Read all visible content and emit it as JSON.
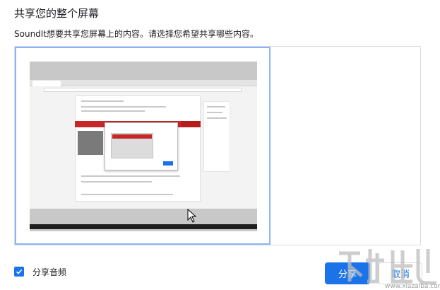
{
  "dialog": {
    "title": "共享您的整个屏幕",
    "description": "SoundIt想要共享您屏幕上的内容。请选择您希望共享哪些内容。"
  },
  "sources": [
    {
      "type": "entire-screen",
      "selected": true
    }
  ],
  "audio": {
    "label": "分享音频",
    "checked": true
  },
  "buttons": {
    "share_label": "分享",
    "cancel_label": "取消"
  },
  "colors": {
    "accent": "#1a73e8",
    "selection_border": "#8ab4f8",
    "border": "#dadce0"
  },
  "watermark": {
    "url": "www.xiazaiba.com"
  }
}
